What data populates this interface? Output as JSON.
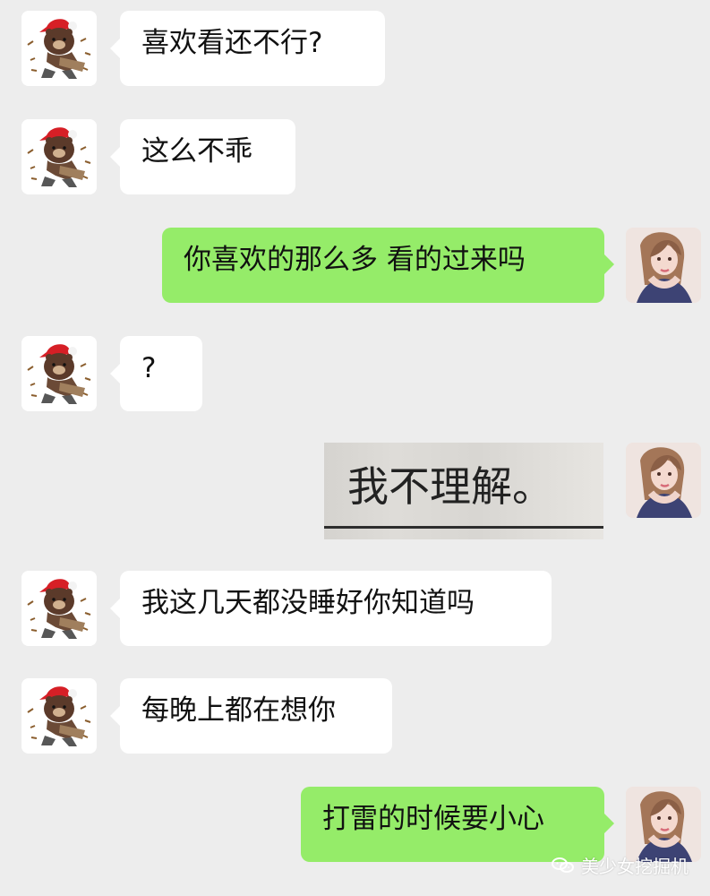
{
  "messages": [
    {
      "side": "left",
      "text": "喜欢看还不行?"
    },
    {
      "side": "left",
      "text": "这么不乖"
    },
    {
      "side": "right",
      "text": "你喜欢的那么多 看的过来吗"
    },
    {
      "side": "left",
      "text": "?"
    },
    {
      "side": "right",
      "image_text": "我不理解。"
    },
    {
      "side": "left",
      "text": "我这几天都没睡好你知道吗"
    },
    {
      "side": "left",
      "text": "每晚上都在想你"
    },
    {
      "side": "right",
      "text": "打雷的时候要小心"
    }
  ],
  "avatars": {
    "left": "bear-avatar",
    "right": "woman-avatar"
  },
  "watermark": {
    "text": "美少女挖掘机",
    "icon": "wechat-icon"
  },
  "colors": {
    "background": "#ededed",
    "left_bubble": "#ffffff",
    "right_bubble": "#95ec69",
    "text": "#111111"
  }
}
